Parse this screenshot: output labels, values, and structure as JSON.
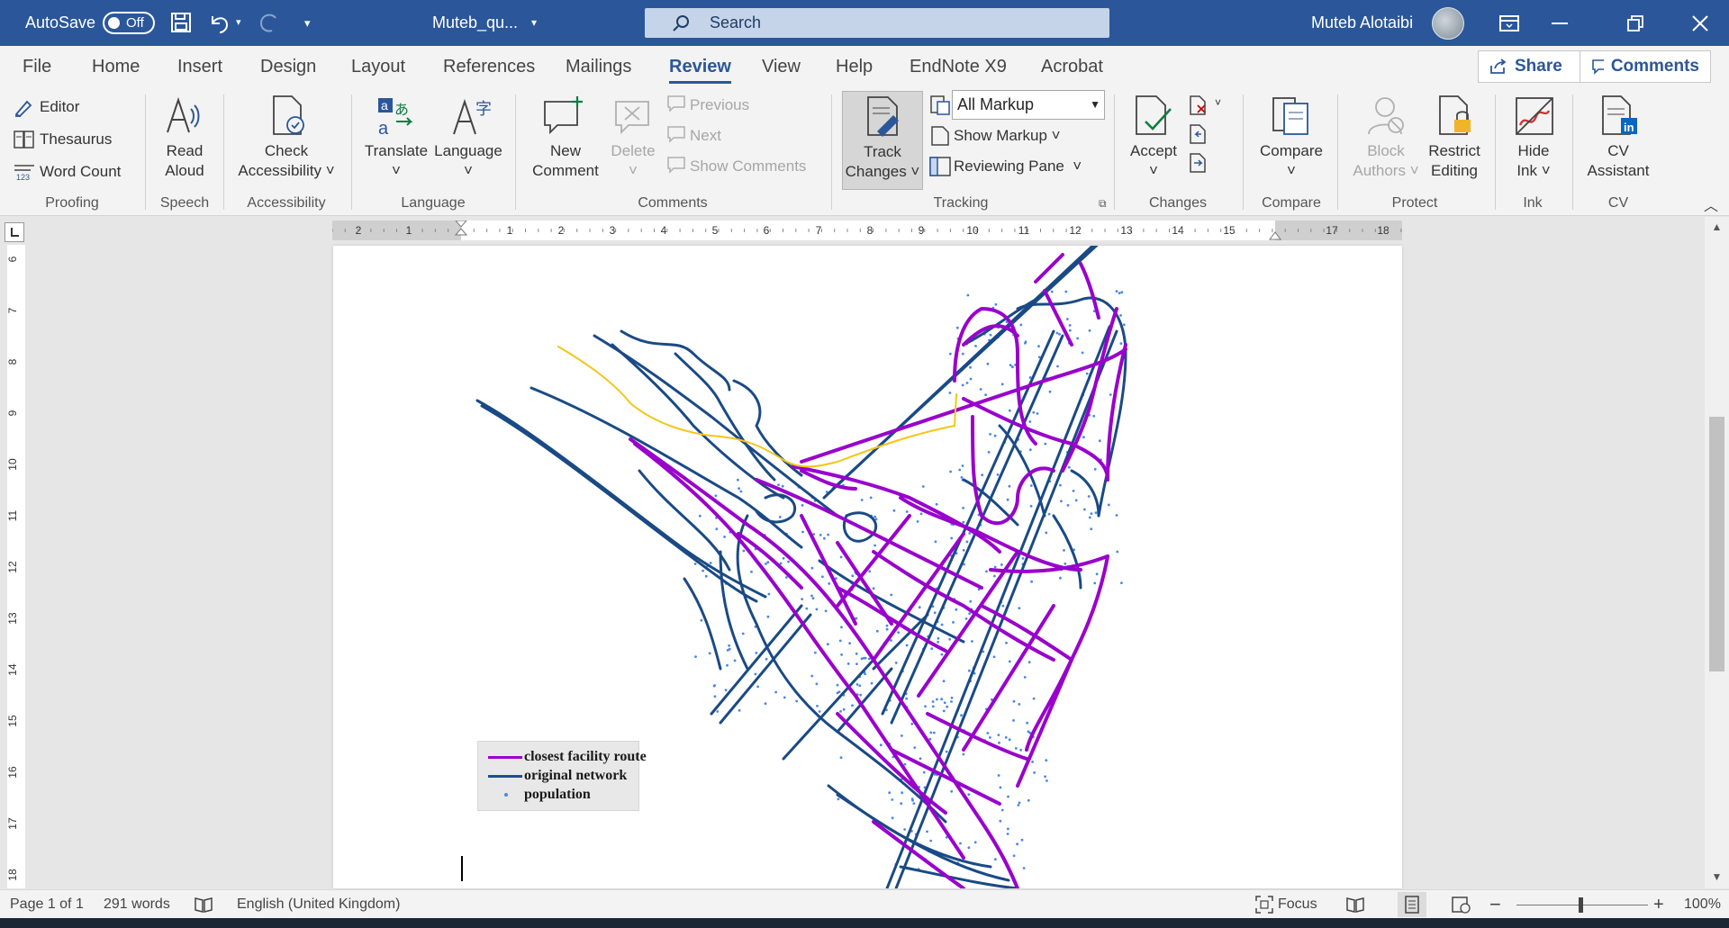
{
  "titlebar": {
    "autosave_label": "AutoSave",
    "autosave_state": "Off",
    "doc_title": "Muteb_qu...",
    "search_placeholder": "Search",
    "user_name": "Muteb Alotaibi"
  },
  "tabs": [
    "File",
    "Home",
    "Insert",
    "Design",
    "Layout",
    "References",
    "Mailings",
    "Review",
    "View",
    "Help",
    "EndNote X9",
    "Acrobat"
  ],
  "active_tab": "Review",
  "top_buttons": {
    "share": "Share",
    "comments": "Comments"
  },
  "ribbon": {
    "proofing": {
      "editor": "Editor",
      "thesaurus": "Thesaurus",
      "word_count": "Word Count",
      "group": "Proofing"
    },
    "speech": {
      "read": "Read",
      "aloud": "Aloud",
      "group": "Speech"
    },
    "accessibility": {
      "check": "Check",
      "accessibility": "Accessibility",
      "group": "Accessibility"
    },
    "language": {
      "translate": "Translate",
      "language": "Language",
      "group": "Language"
    },
    "comments": {
      "new": "New",
      "comment": "Comment",
      "delete": "Delete",
      "previous": "Previous",
      "next": "Next",
      "show_comments": "Show Comments",
      "group": "Comments"
    },
    "tracking": {
      "track": "Track",
      "changes": "Changes",
      "markup_value": "All Markup",
      "show_markup": "Show Markup",
      "reviewing_pane": "Reviewing Pane",
      "group": "Tracking"
    },
    "changes": {
      "accept": "Accept",
      "group": "Changes"
    },
    "compare": {
      "compare": "Compare",
      "group": "Compare"
    },
    "protect": {
      "block": "Block",
      "authors": "Authors",
      "restrict": "Restrict",
      "editing": "Editing",
      "group": "Protect"
    },
    "ink": {
      "hide": "Hide",
      "ink": "Ink",
      "group": "Ink"
    },
    "cv": {
      "cv": "CV",
      "assistant": "Assistant",
      "group": "CV"
    }
  },
  "ruler_h": [
    "2",
    "1",
    "1",
    "2",
    "3",
    "4",
    "5",
    "6",
    "7",
    "8",
    "9",
    "10",
    "11",
    "12",
    "13",
    "14",
    "15",
    "17",
    "18"
  ],
  "ruler_v": [
    "6",
    "7",
    "8",
    "9",
    "10",
    "11",
    "12",
    "13",
    "14",
    "15",
    "16",
    "17",
    "18"
  ],
  "legend": [
    {
      "label": "closest facility route",
      "color": "#9900cc",
      "kind": "line"
    },
    {
      "label": "original network",
      "color": "#1f4e8c",
      "kind": "line"
    },
    {
      "label": "population",
      "color": "#4a86e8",
      "kind": "dot"
    }
  ],
  "map_colors": {
    "network": "#1a4a85",
    "route": "#9900cc",
    "highlight": "#f5c518",
    "population": "#4a86e8"
  },
  "statusbar": {
    "page": "Page 1 of 1",
    "words": "291 words",
    "language": "English (United Kingdom)",
    "focus": "Focus",
    "zoom": "100%"
  }
}
